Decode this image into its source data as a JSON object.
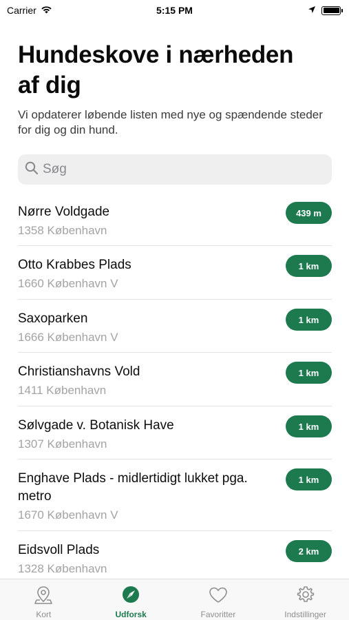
{
  "status_bar": {
    "carrier": "Carrier",
    "time": "5:15 PM"
  },
  "header": {
    "title": "Hundeskove i nærheden af dig",
    "subtitle": "Vi opdaterer løbende listen med nye og spændende steder for dig og din hund."
  },
  "search": {
    "placeholder": "Søg",
    "value": ""
  },
  "places": [
    {
      "name": "Nørre Voldgade",
      "address": "1358 København",
      "distance": "439 m"
    },
    {
      "name": "Otto Krabbes Plads",
      "address": "1660 København V",
      "distance": "1 km"
    },
    {
      "name": "Saxoparken",
      "address": "1666 København V",
      "distance": "1 km"
    },
    {
      "name": "Christianshavns Vold",
      "address": "1411 København",
      "distance": "1 km"
    },
    {
      "name": "Sølvgade v. Botanisk Have",
      "address": "1307 København",
      "distance": "1 km"
    },
    {
      "name": "Enghave Plads - midlertidigt lukket pga. metro",
      "address": "1670 København V",
      "distance": "1 km"
    },
    {
      "name": "Eidsvoll Plads",
      "address": "1328 København",
      "distance": "2 km"
    }
  ],
  "tabs": [
    {
      "label": "Kort",
      "icon": "map-pin-icon",
      "active": false
    },
    {
      "label": "Udforsk",
      "icon": "compass-icon",
      "active": true
    },
    {
      "label": "Favoritter",
      "icon": "heart-icon",
      "active": false
    },
    {
      "label": "Indstillinger",
      "icon": "gear-icon",
      "active": false
    }
  ],
  "colors": {
    "accent": "#1d7a4f",
    "inactive": "#8e8e8e"
  }
}
